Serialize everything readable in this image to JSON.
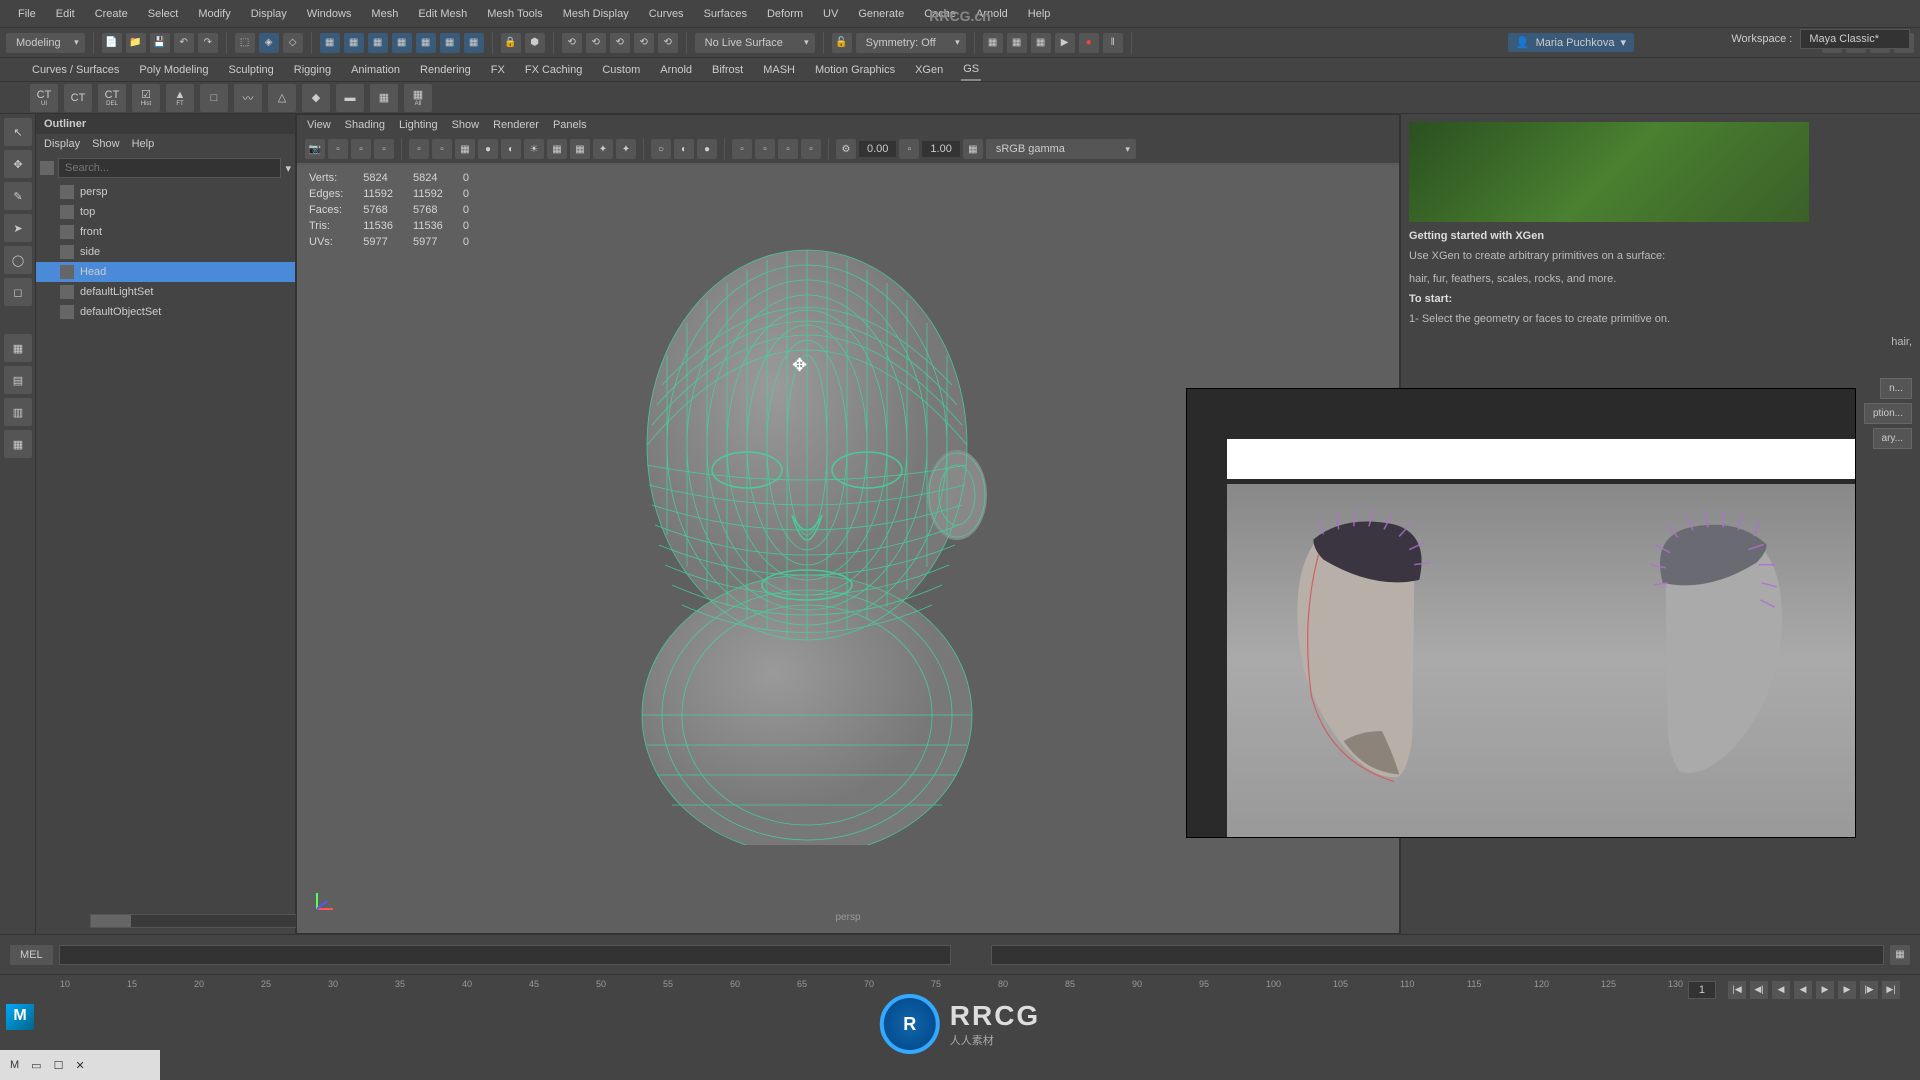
{
  "brand": "RRCG.cn",
  "menubar": [
    "File",
    "Edit",
    "Create",
    "Select",
    "Modify",
    "Display",
    "Windows",
    "Mesh",
    "Edit Mesh",
    "Mesh Tools",
    "Mesh Display",
    "Curves",
    "Surfaces",
    "Deform",
    "UV",
    "Generate",
    "Cache",
    "Arnold",
    "Help"
  ],
  "workspace": {
    "label": "Workspace :",
    "value": "Maya Classic*"
  },
  "modeDropdown": "Modeling",
  "symmetry": "Symmetry: Off",
  "surface": "No Live Surface",
  "user": "Maria Puchkova",
  "shelves": [
    "Curves / Surfaces",
    "Poly Modeling",
    "Sculpting",
    "Rigging",
    "Animation",
    "Rendering",
    "FX",
    "FX Caching",
    "Custom",
    "Arnold",
    "Bifrost",
    "MASH",
    "Motion Graphics",
    "XGen",
    "GS"
  ],
  "shelfActive": "GS",
  "shelfIcons": [
    {
      "t": "CT",
      "s": "UI"
    },
    {
      "t": "CT",
      "s": ""
    },
    {
      "t": "CT",
      "s": "DEL"
    },
    {
      "t": "☑",
      "s": "Hist"
    },
    {
      "t": "▲",
      "s": "FT"
    },
    {
      "t": "□",
      "s": ""
    },
    {
      "t": "〰",
      "s": ""
    },
    {
      "t": "△",
      "s": ""
    },
    {
      "t": "◆",
      "s": ""
    },
    {
      "t": "▬",
      "s": ""
    },
    {
      "t": "▦",
      "s": ""
    },
    {
      "t": "▦",
      "s": "All"
    }
  ],
  "outliner": {
    "title": "Outliner",
    "menus": [
      "Display",
      "Show",
      "Help"
    ],
    "searchPlaceholder": "Search...",
    "items": [
      {
        "name": "persp",
        "icon": "cam"
      },
      {
        "name": "top",
        "icon": "cam"
      },
      {
        "name": "front",
        "icon": "cam"
      },
      {
        "name": "side",
        "icon": "cam"
      },
      {
        "name": "Head",
        "icon": "mesh",
        "selected": true
      },
      {
        "name": "defaultLightSet",
        "icon": "set"
      },
      {
        "name": "defaultObjectSet",
        "icon": "set"
      }
    ]
  },
  "viewport": {
    "menus": [
      "View",
      "Shading",
      "Lighting",
      "Show",
      "Renderer",
      "Panels"
    ],
    "num1": "0.00",
    "num2": "1.00",
    "colormode": "sRGB gamma",
    "stats": [
      {
        "k": "Verts:",
        "a": "5824",
        "b": "5824",
        "c": "0"
      },
      {
        "k": "Edges:",
        "a": "11592",
        "b": "11592",
        "c": "0"
      },
      {
        "k": "Faces:",
        "a": "5768",
        "b": "5768",
        "c": "0"
      },
      {
        "k": "Tris:",
        "a": "11536",
        "b": "11536",
        "c": "0"
      },
      {
        "k": "UVs:",
        "a": "5977",
        "b": "5977",
        "c": "0"
      }
    ],
    "camera": "persp"
  },
  "xgen": {
    "title": "Getting started with XGen",
    "line1": "Use XGen to create arbitrary primitives on a surface:",
    "line2": "hair, fur, feathers, scales, rocks, and more.",
    "startTitle": "To start:",
    "step1": "1- Select the geometry or faces to create primitive on.",
    "step2tail": "hair,",
    "btn1": "n...",
    "btn2": "ption...",
    "btn3": "ary..."
  },
  "mel": "MEL",
  "ruler": {
    "start": 10,
    "step": 5,
    "count": 25
  },
  "frame": "1",
  "logo": {
    "main": "RRCG",
    "sub": "人人素材"
  }
}
